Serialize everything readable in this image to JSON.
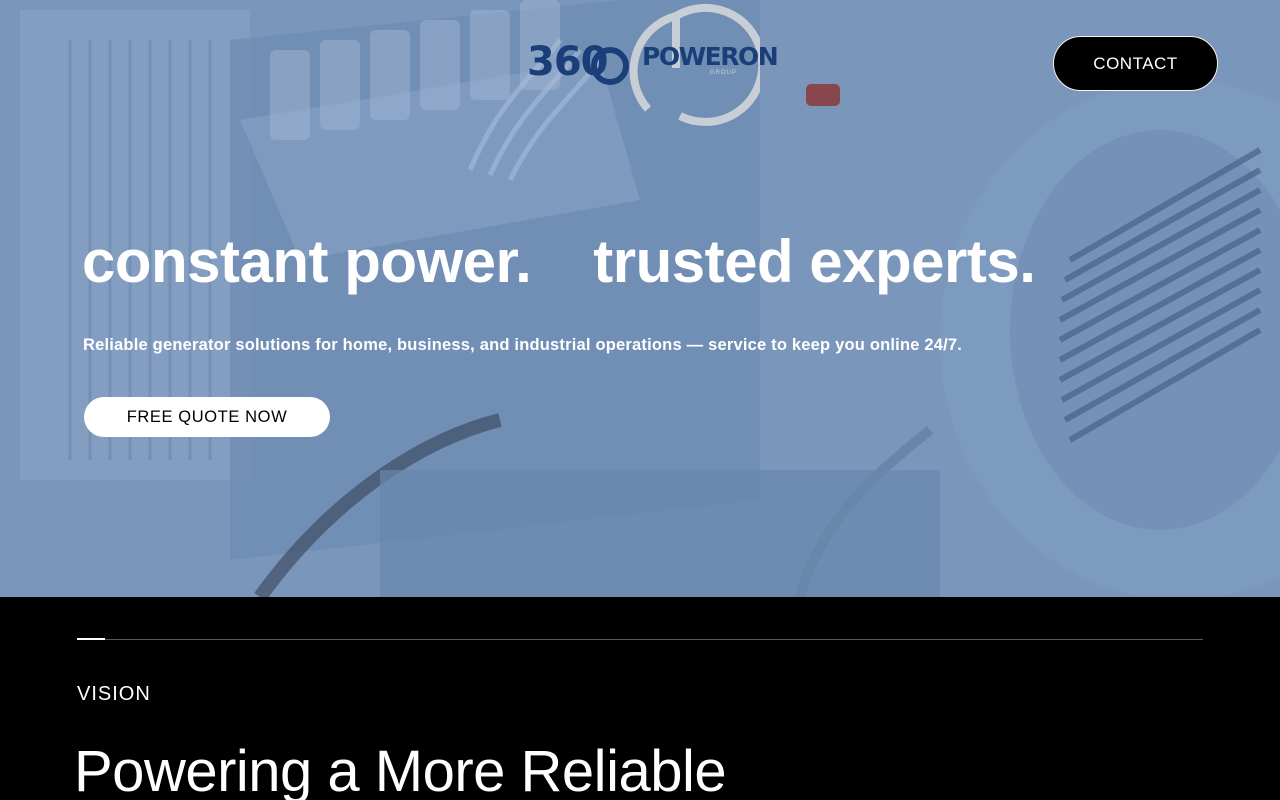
{
  "header": {
    "logo": {
      "number": "360",
      "brand": "POWERON",
      "sub": "GROUP"
    },
    "contact_label": "CONTACT"
  },
  "hero": {
    "headline_part1": "constant power.",
    "headline_part2": "trusted experts.",
    "subtitle": "Reliable generator solutions for home, business, and industrial operations — service to keep you online 24/7.",
    "cta_label": "FREE QUOTE NOW"
  },
  "vision": {
    "label": "VISION",
    "heading": "Powering a More Reliable"
  },
  "colors": {
    "hero_overlay": "#7592b8",
    "logo_blue": "#1a3f78",
    "logo_ring": "#c8ced6",
    "section_bg": "#000000",
    "text_light": "#ffffff"
  },
  "icons": {
    "logo_mark": "power-ring-icon"
  }
}
